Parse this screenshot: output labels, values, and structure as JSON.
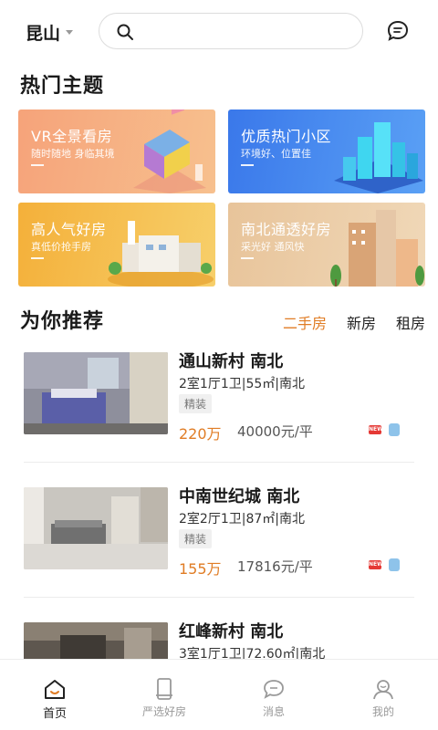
{
  "header": {
    "city": "昆山",
    "search_placeholder": "",
    "icons": {
      "caret": "caret-down-icon",
      "search": "search-icon",
      "message": "chat-bubble-icon"
    }
  },
  "hot": {
    "title": "热门主题",
    "cards": [
      {
        "title": "VR全景看房",
        "subtitle": "随时随地 身临其境",
        "color": "#f6a37a"
      },
      {
        "title": "优质热门小区",
        "subtitle": "环境好、位置佳",
        "color": "#3a78ea"
      },
      {
        "title": "高人气好房",
        "subtitle": "真低价抢手房",
        "color": "#f4b03a"
      },
      {
        "title": "南北通透好房",
        "subtitle": "采光好 通风快",
        "color": "#e8c49a"
      }
    ]
  },
  "recommend": {
    "title": "为你推荐",
    "tabs": [
      "二手房",
      "新房",
      "租房"
    ],
    "active_tab": "二手房",
    "accent": "#e07c24",
    "listings": [
      {
        "name": "通山新村 南北",
        "spec": "2室1厅1卫|55㎡|南北",
        "tag": "精装",
        "price": "220万",
        "unit_price": "40000元/平"
      },
      {
        "name": "中南世纪城 南北",
        "spec": "2室2厅1卫|87㎡|南北",
        "tag": "精装",
        "price": "155万",
        "unit_price": "17816元/平"
      },
      {
        "name": "红峰新村 南北",
        "spec": "3室1厅1卫|72.60㎡|南北",
        "tag": "",
        "price": "",
        "unit_price": ""
      }
    ],
    "badges": {
      "new": "NEW",
      "vr": "vr-badge-icon"
    }
  },
  "nav": {
    "items": [
      {
        "label": "首页",
        "icon": "home-icon"
      },
      {
        "label": "严选好房",
        "icon": "phone-icon"
      },
      {
        "label": "消息",
        "icon": "chat-icon"
      },
      {
        "label": "我的",
        "icon": "user-icon"
      }
    ],
    "active": "首页"
  }
}
